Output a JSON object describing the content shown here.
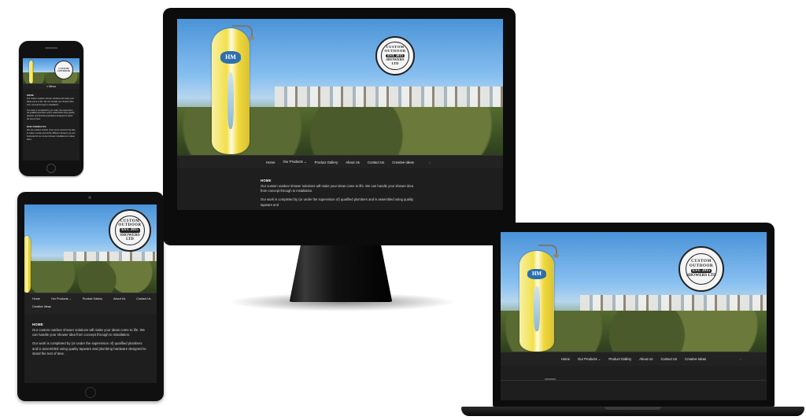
{
  "site": {
    "logo_lines": [
      "CUSTOM OUTDOOR",
      "EST. 2015",
      "SHOWERS LTD"
    ],
    "board_mark": "HM",
    "nav": [
      {
        "label": "Home"
      },
      {
        "label": "Our Products",
        "suffix": "⌄"
      },
      {
        "label": "Product Gallery"
      },
      {
        "label": "About Us"
      },
      {
        "label": "Contact Us"
      },
      {
        "label": "Creative Ideas"
      }
    ],
    "mobile_menu_label": "≡ Menu",
    "scroll_arrow": "↓",
    "home_heading": "HOME",
    "paragraph_1": "Our custom outdoor shower solutions will make your ideas come to life. We can handle your shower idea from concept through to installation.",
    "paragraph_2": "Our work is completed by (or under the supervision of) qualified plumbers and is assembled using quality tapware and plumbing hardware designed to stand the test of time.",
    "paragraph_2_short": "Our work is completed by (or under the supervision of) qualified plumbers and is assembled using quality tapware and",
    "phone_heading_2": "OUR PRODUCTS",
    "phone_paragraph_3": "We can outdoor shower once you're turned to be able to make a sense and all the different showers you are interested of our current shower installations to ideas there."
  },
  "colors": {
    "device_bezel": "#0c0c0c",
    "site_background": "#1e1e1e",
    "nav_background": "#222222",
    "nav_text": "#eeeeee"
  }
}
